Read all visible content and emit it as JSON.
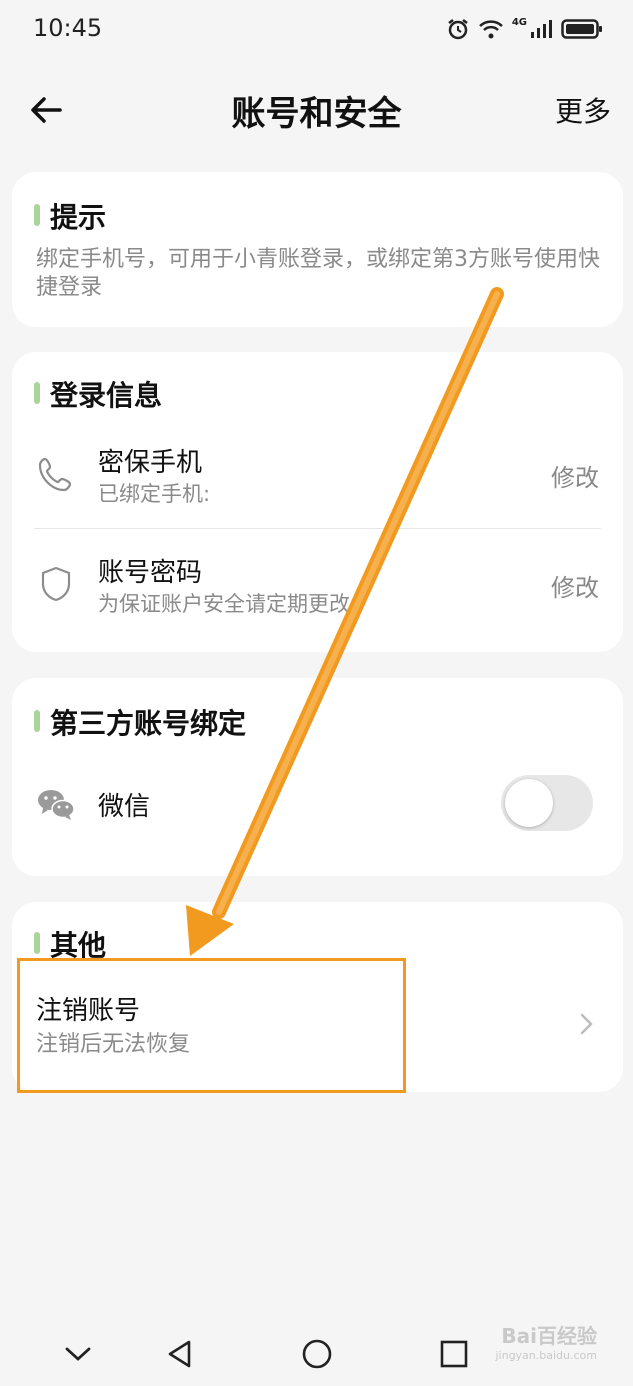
{
  "status_bar": {
    "time": "10:45",
    "network": "4G"
  },
  "header": {
    "title": "账号和安全",
    "more_label": "更多"
  },
  "tip_card": {
    "title": "提示",
    "text": "绑定手机号，可用于小青账登录，或绑定第3方账号使用快捷登录"
  },
  "login_info": {
    "title": "登录信息",
    "rows": [
      {
        "title": "密保手机",
        "subtitle": "已绑定手机:",
        "action": "修改"
      },
      {
        "title": "账号密码",
        "subtitle": "为保证账户安全请定期更改",
        "action": "修改"
      }
    ]
  },
  "third_party": {
    "title": "第三方账号绑定",
    "wechat": {
      "label": "微信",
      "enabled": false
    }
  },
  "other": {
    "title": "其他",
    "cancel_account": {
      "title": "注销账号",
      "subtitle": "注销后无法恢复"
    }
  },
  "watermark": {
    "line1": "Bai百经验",
    "line2": "jingyan.baidu.com"
  },
  "colors": {
    "accent_bar": "#a9d49b",
    "annotation": "#f29a1f",
    "background": "#f5f5f5"
  }
}
